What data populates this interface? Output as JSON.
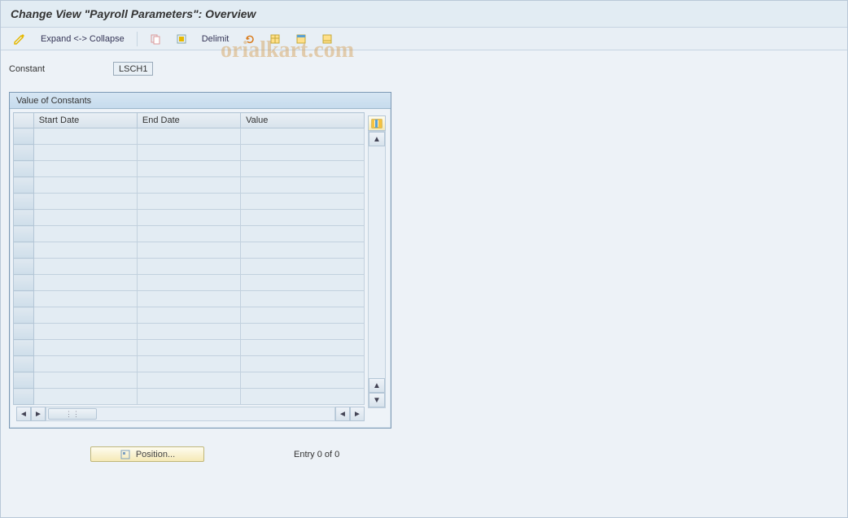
{
  "title": "Change View \"Payroll Parameters\": Overview",
  "toolbar": {
    "expand_collapse": "Expand <-> Collapse",
    "delimit": "Delimit"
  },
  "form": {
    "constant_label": "Constant",
    "constant_value": "LSCH1"
  },
  "panel": {
    "title": "Value of Constants",
    "columns": {
      "start_date": "Start Date",
      "end_date": "End Date",
      "value": "Value"
    },
    "rows": [
      {
        "start": "",
        "end": "",
        "value": ""
      },
      {
        "start": "",
        "end": "",
        "value": ""
      },
      {
        "start": "",
        "end": "",
        "value": ""
      },
      {
        "start": "",
        "end": "",
        "value": ""
      },
      {
        "start": "",
        "end": "",
        "value": ""
      },
      {
        "start": "",
        "end": "",
        "value": ""
      },
      {
        "start": "",
        "end": "",
        "value": ""
      },
      {
        "start": "",
        "end": "",
        "value": ""
      },
      {
        "start": "",
        "end": "",
        "value": ""
      },
      {
        "start": "",
        "end": "",
        "value": ""
      },
      {
        "start": "",
        "end": "",
        "value": ""
      },
      {
        "start": "",
        "end": "",
        "value": ""
      },
      {
        "start": "",
        "end": "",
        "value": ""
      },
      {
        "start": "",
        "end": "",
        "value": ""
      },
      {
        "start": "",
        "end": "",
        "value": ""
      },
      {
        "start": "",
        "end": "",
        "value": ""
      },
      {
        "start": "",
        "end": "",
        "value": ""
      }
    ]
  },
  "footer": {
    "position_label": "Position...",
    "entry_text": "Entry 0 of 0"
  },
  "watermark": "orialkart.com"
}
